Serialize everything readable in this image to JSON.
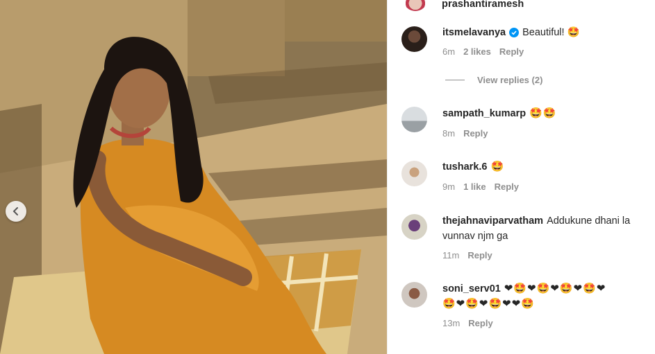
{
  "post": {
    "author": "prashantiramesh"
  },
  "photo": {
    "prev_icon": "chevron-left-icon"
  },
  "comments": [
    {
      "user": "itsmelavanya",
      "verified": true,
      "text": "Beautiful! 🤩",
      "time": "6m",
      "likes": "2 likes",
      "reply": "Reply"
    },
    {
      "user": "sampath_kumarp",
      "verified": false,
      "text": "🤩🤩",
      "time": "8m",
      "likes": "",
      "reply": "Reply"
    },
    {
      "user": "tushark.6",
      "verified": false,
      "text": "🤩",
      "time": "9m",
      "likes": "1 like",
      "reply": "Reply"
    },
    {
      "user": "thejahnaviparvatham",
      "verified": false,
      "text": "Addukune dhani la vunnav njm ga",
      "time": "11m",
      "likes": "",
      "reply": "Reply"
    },
    {
      "user": "soni_serv01",
      "verified": false,
      "text": "❤🤩❤🤩❤🤩❤🤩❤",
      "text2": "🤩❤🤩❤🤩❤❤🤩",
      "time": "13m",
      "likes": "",
      "reply": "Reply"
    }
  ],
  "view_replies": "View replies (2)",
  "colors": {
    "username": "#262626",
    "meta": "#8e8e8e",
    "verified": "#0095f6"
  }
}
